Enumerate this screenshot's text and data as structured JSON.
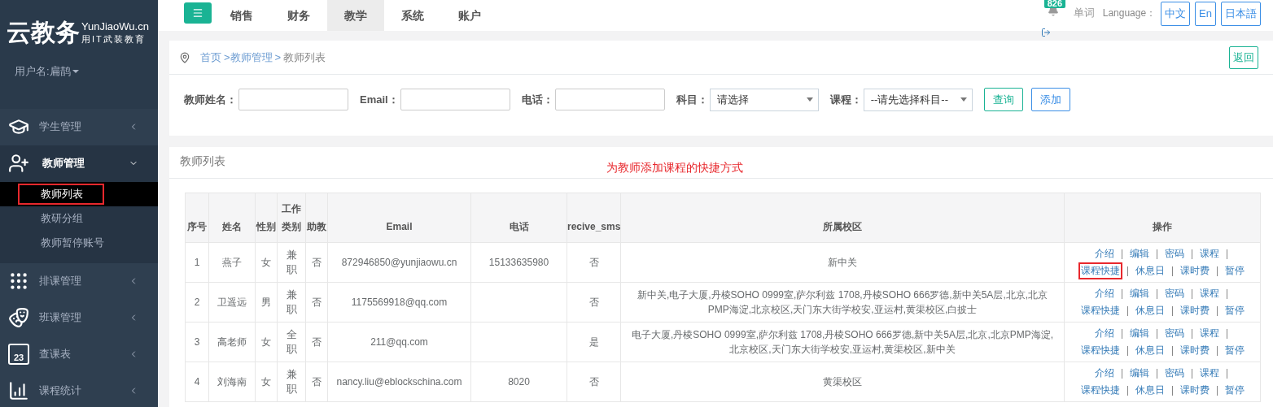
{
  "sidebar": {
    "logo": {
      "name": "云教务",
      "domain": "YunJiaoWu.cn",
      "slogan": "用IT武装教育"
    },
    "user": "用户名:扁鹊",
    "items": [
      {
        "kind": "cap",
        "label": "学生管理",
        "expanded": false
      },
      {
        "kind": "user-plus",
        "label": "教师管理",
        "expanded": true,
        "children": [
          {
            "label": "教师列表",
            "selected": true,
            "highlighted": true
          },
          {
            "label": "教研分组",
            "selected": false,
            "highlighted": false
          },
          {
            "label": "教师暂停账号",
            "selected": false,
            "highlighted": false
          }
        ]
      },
      {
        "kind": "grid",
        "label": "排课管理",
        "expanded": false
      },
      {
        "kind": "masks",
        "label": "班课管理",
        "expanded": false
      },
      {
        "kind": "calendar",
        "label": "查课表",
        "expanded": false,
        "icon_text": "23"
      },
      {
        "kind": "chart",
        "label": "课程统计",
        "expanded": false
      }
    ]
  },
  "topnav": {
    "tabs": [
      {
        "label": "销售",
        "selected": false
      },
      {
        "label": "财务",
        "selected": false
      },
      {
        "label": "教学",
        "selected": true
      },
      {
        "label": "系统",
        "selected": false
      },
      {
        "label": "账户",
        "selected": false
      }
    ],
    "notification_count": "826",
    "words_link": "单词",
    "language_label": "Language：",
    "languages": [
      "中文",
      "En",
      "日本語"
    ]
  },
  "breadcrumb": {
    "items": [
      "首页",
      ">教师管理",
      ">",
      "教师列表"
    ],
    "back_button": "返回"
  },
  "filters": {
    "fields": [
      {
        "kind": "input",
        "label": "教师姓名："
      },
      {
        "kind": "input",
        "label": "Email："
      },
      {
        "kind": "input",
        "label": "电话："
      },
      {
        "kind": "select",
        "label": "科目：",
        "value": "请选择"
      },
      {
        "kind": "select",
        "label": "课程：",
        "value": "--请先选择科目--"
      }
    ],
    "search_button": "查询",
    "add_button": "添加"
  },
  "table_panel": {
    "title": "教师列表",
    "annotation": "为教师添加课程的快捷方式",
    "columns": [
      "序号",
      "姓名",
      "性别",
      "工作类别",
      "助教",
      "Email",
      "电话",
      "recive_sms",
      "所属校区",
      "操作"
    ],
    "rows": [
      {
        "cells": [
          "1",
          "燕子",
          "女",
          "兼职",
          "否",
          "872946850@yunjiaowu.cn",
          "15133635980",
          "否",
          "新中关"
        ],
        "actions": [
          {
            "label": "介绍",
            "highlighted": false
          },
          {
            "label": "编辑",
            "highlighted": false
          },
          {
            "label": "密码",
            "highlighted": false
          },
          {
            "label": "课程",
            "highlighted": false
          },
          {
            "label": "课程快捷",
            "highlighted": true
          },
          {
            "label": "休息日",
            "highlighted": false
          },
          {
            "label": "课时费",
            "highlighted": false
          },
          {
            "label": "暂停",
            "highlighted": false
          }
        ]
      },
      {
        "cells": [
          "2",
          "卫遥远",
          "男",
          "兼职",
          "否",
          "1175569918@qq.com",
          "",
          "否",
          "新中关,电子大厦,丹棱SOHO 0999室,萨尔利兹 1708,丹棱SOHO 666罗德,新中关5A层,北京,北京PMP海淀,北京校区,天门东大街学校安,亚运村,黄渠校区,白披士"
        ],
        "actions": [
          {
            "label": "介绍",
            "highlighted": false
          },
          {
            "label": "编辑",
            "highlighted": false
          },
          {
            "label": "密码",
            "highlighted": false
          },
          {
            "label": "课程",
            "highlighted": false
          },
          {
            "label": "课程快捷",
            "highlighted": false
          },
          {
            "label": "休息日",
            "highlighted": false
          },
          {
            "label": "课时费",
            "highlighted": false
          },
          {
            "label": "暂停",
            "highlighted": false
          }
        ]
      },
      {
        "cells": [
          "3",
          "高老师",
          "女",
          "全职",
          "否",
          "211@qq.com",
          "",
          "是",
          "电子大厦,丹棱SOHO 0999室,萨尔利兹 1708,丹棱SOHO 666罗德,新中关5A层,北京,北京PMP海淀,北京校区,天门东大街学校安,亚运村,黄渠校区,新中关"
        ],
        "actions": [
          {
            "label": "介绍",
            "highlighted": false
          },
          {
            "label": "编辑",
            "highlighted": false
          },
          {
            "label": "密码",
            "highlighted": false
          },
          {
            "label": "课程",
            "highlighted": false
          },
          {
            "label": "课程快捷",
            "highlighted": false
          },
          {
            "label": "休息日",
            "highlighted": false
          },
          {
            "label": "课时费",
            "highlighted": false
          },
          {
            "label": "暂停",
            "highlighted": false
          }
        ]
      },
      {
        "cells": [
          "4",
          "刘海南",
          "女",
          "兼职",
          "否",
          "nancy.liu@eblockschina.com",
          "8020",
          "否",
          "黄渠校区"
        ],
        "actions": [
          {
            "label": "介绍",
            "highlighted": false
          },
          {
            "label": "编辑",
            "highlighted": false
          },
          {
            "label": "密码",
            "highlighted": false
          },
          {
            "label": "课程",
            "highlighted": false
          },
          {
            "label": "课程快捷",
            "highlighted": false
          },
          {
            "label": "休息日",
            "highlighted": false
          },
          {
            "label": "课时费",
            "highlighted": false
          },
          {
            "label": "暂停",
            "highlighted": false
          }
        ]
      }
    ]
  }
}
